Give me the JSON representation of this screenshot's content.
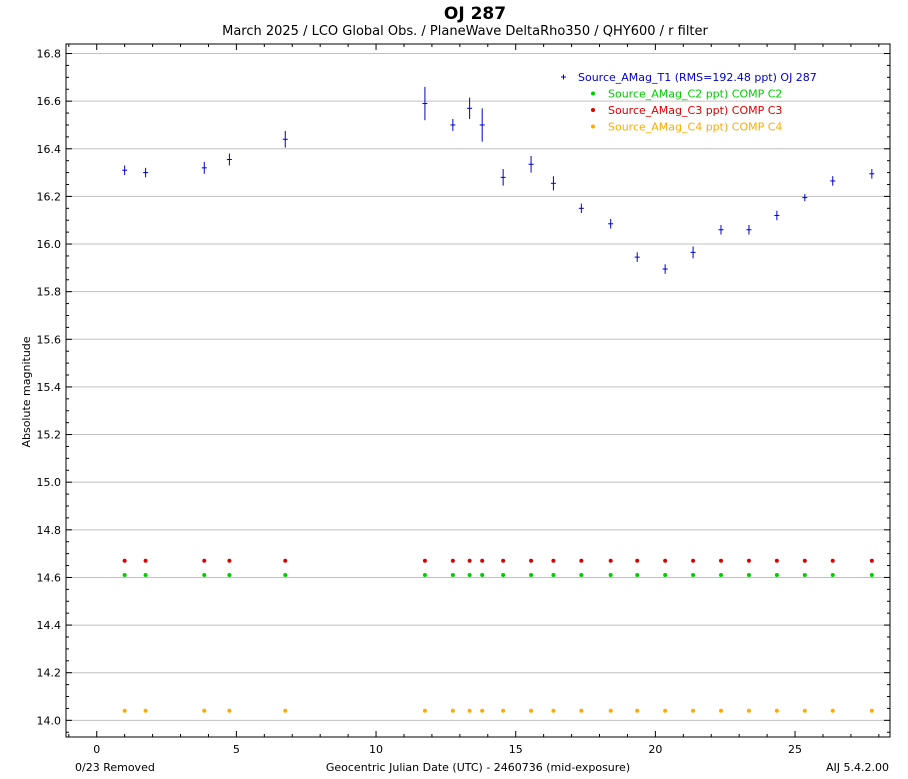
{
  "chart_data": {
    "type": "scatter",
    "title": "OJ 287",
    "subtitle": "March 2025 / LCO Global Obs. / PlaneWave DeltaRho350 / QHY600 / r filter",
    "xlabel": "Geocentric Julian Date (UTC) - 2460736 (mid-exposure)",
    "ylabel": "Absolute magnitude",
    "xlim": [
      -1.1,
      28.4
    ],
    "ylim": [
      13.93,
      16.84
    ],
    "x_ticks": [
      0,
      5,
      10,
      15,
      20,
      25
    ],
    "y_ticks": [
      14.0,
      14.2,
      14.4,
      14.6,
      14.8,
      15.0,
      15.2,
      15.4,
      15.6,
      15.8,
      16.0,
      16.2,
      16.4,
      16.6,
      16.8
    ],
    "y_tick_labels": [
      "14.0",
      "14.2",
      "14.4",
      "14.6",
      "14.8",
      "15.0",
      "15.2",
      "15.4",
      "15.6",
      "15.8",
      "16.0",
      "16.2",
      "16.4",
      "16.6",
      "16.8"
    ],
    "grid": "horizontal",
    "legend_position": "top-right",
    "x": [
      1.0,
      1.75,
      3.85,
      4.75,
      6.75,
      11.75,
      12.75,
      13.35,
      13.8,
      14.55,
      15.55,
      16.35,
      17.35,
      18.4,
      19.35,
      20.35,
      21.35,
      22.35,
      23.35,
      24.35,
      25.35,
      26.35,
      27.75
    ],
    "series": [
      {
        "name": "Source_AMag_T1 (RMS=192.48 ppt) OJ 287",
        "color": "#0000cc",
        "marker": "plus",
        "values": [
          16.31,
          16.3,
          16.32,
          16.355,
          16.44,
          16.59,
          16.5,
          16.57,
          16.5,
          16.28,
          16.335,
          16.255,
          16.15,
          16.085,
          15.945,
          15.895,
          15.965,
          16.06,
          16.06,
          16.12,
          16.195,
          16.265,
          16.295
        ],
        "errors": [
          0.02,
          0.02,
          0.025,
          0.025,
          0.035,
          0.07,
          0.025,
          0.045,
          0.07,
          0.035,
          0.035,
          0.03,
          0.02,
          0.02,
          0.02,
          0.02,
          0.025,
          0.02,
          0.02,
          0.02,
          0.015,
          0.02,
          0.02
        ]
      },
      {
        "name": "Source_AMag_C2 ppt) COMP C2",
        "color": "#00cc00",
        "marker": "dot",
        "values": [
          14.61,
          14.61,
          14.61,
          14.61,
          14.61,
          14.61,
          14.61,
          14.61,
          14.61,
          14.61,
          14.61,
          14.61,
          14.61,
          14.61,
          14.61,
          14.61,
          14.61,
          14.61,
          14.61,
          14.61,
          14.61,
          14.61,
          14.61
        ]
      },
      {
        "name": "Source_AMag_C3 ppt) COMP C3",
        "color": "#dd0000",
        "marker": "dot",
        "values": [
          14.67,
          14.67,
          14.67,
          14.67,
          14.67,
          14.67,
          14.67,
          14.67,
          14.67,
          14.67,
          14.67,
          14.67,
          14.67,
          14.67,
          14.67,
          14.67,
          14.67,
          14.67,
          14.67,
          14.67,
          14.67,
          14.67,
          14.67
        ]
      },
      {
        "name": "Source_AMag_C4 ppt) COMP C4",
        "color": "#ffaa00",
        "marker": "dot",
        "values": [
          14.04,
          14.04,
          14.04,
          14.04,
          14.04,
          14.04,
          14.04,
          14.04,
          14.04,
          14.04,
          14.04,
          14.04,
          14.04,
          14.04,
          14.04,
          14.04,
          14.04,
          14.04,
          14.04,
          14.04,
          14.04,
          14.04,
          14.04
        ]
      }
    ]
  },
  "footer": {
    "left": "0/23 Removed",
    "right": "AIJ 5.4.2.00"
  }
}
